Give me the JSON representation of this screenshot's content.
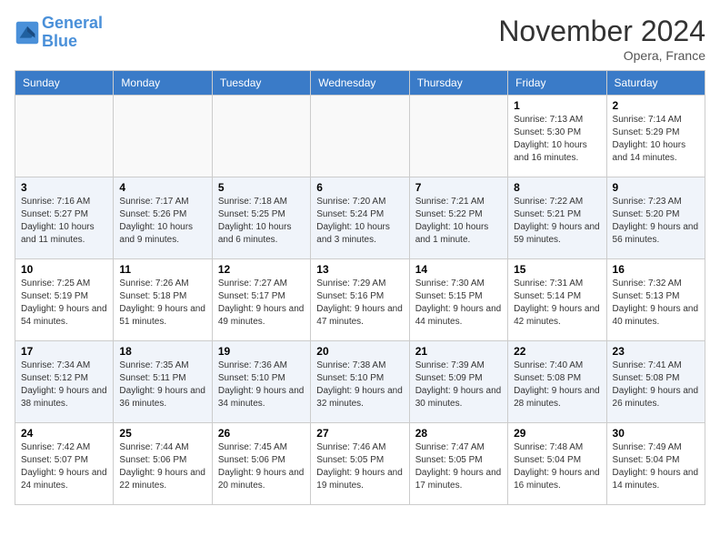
{
  "logo": {
    "text_general": "General",
    "text_blue": "Blue"
  },
  "title": "November 2024",
  "location": "Opera, France",
  "days_of_week": [
    "Sunday",
    "Monday",
    "Tuesday",
    "Wednesday",
    "Thursday",
    "Friday",
    "Saturday"
  ],
  "weeks": [
    [
      {
        "day": "",
        "sunrise": "",
        "sunset": "",
        "daylight": "",
        "empty": true
      },
      {
        "day": "",
        "sunrise": "",
        "sunset": "",
        "daylight": "",
        "empty": true
      },
      {
        "day": "",
        "sunrise": "",
        "sunset": "",
        "daylight": "",
        "empty": true
      },
      {
        "day": "",
        "sunrise": "",
        "sunset": "",
        "daylight": "",
        "empty": true
      },
      {
        "day": "",
        "sunrise": "",
        "sunset": "",
        "daylight": "",
        "empty": true
      },
      {
        "day": "1",
        "sunrise": "Sunrise: 7:13 AM",
        "sunset": "Sunset: 5:30 PM",
        "daylight": "Daylight: 10 hours and 16 minutes."
      },
      {
        "day": "2",
        "sunrise": "Sunrise: 7:14 AM",
        "sunset": "Sunset: 5:29 PM",
        "daylight": "Daylight: 10 hours and 14 minutes."
      }
    ],
    [
      {
        "day": "3",
        "sunrise": "Sunrise: 7:16 AM",
        "sunset": "Sunset: 5:27 PM",
        "daylight": "Daylight: 10 hours and 11 minutes."
      },
      {
        "day": "4",
        "sunrise": "Sunrise: 7:17 AM",
        "sunset": "Sunset: 5:26 PM",
        "daylight": "Daylight: 10 hours and 9 minutes."
      },
      {
        "day": "5",
        "sunrise": "Sunrise: 7:18 AM",
        "sunset": "Sunset: 5:25 PM",
        "daylight": "Daylight: 10 hours and 6 minutes."
      },
      {
        "day": "6",
        "sunrise": "Sunrise: 7:20 AM",
        "sunset": "Sunset: 5:24 PM",
        "daylight": "Daylight: 10 hours and 3 minutes."
      },
      {
        "day": "7",
        "sunrise": "Sunrise: 7:21 AM",
        "sunset": "Sunset: 5:22 PM",
        "daylight": "Daylight: 10 hours and 1 minute."
      },
      {
        "day": "8",
        "sunrise": "Sunrise: 7:22 AM",
        "sunset": "Sunset: 5:21 PM",
        "daylight": "Daylight: 9 hours and 59 minutes."
      },
      {
        "day": "9",
        "sunrise": "Sunrise: 7:23 AM",
        "sunset": "Sunset: 5:20 PM",
        "daylight": "Daylight: 9 hours and 56 minutes."
      }
    ],
    [
      {
        "day": "10",
        "sunrise": "Sunrise: 7:25 AM",
        "sunset": "Sunset: 5:19 PM",
        "daylight": "Daylight: 9 hours and 54 minutes."
      },
      {
        "day": "11",
        "sunrise": "Sunrise: 7:26 AM",
        "sunset": "Sunset: 5:18 PM",
        "daylight": "Daylight: 9 hours and 51 minutes."
      },
      {
        "day": "12",
        "sunrise": "Sunrise: 7:27 AM",
        "sunset": "Sunset: 5:17 PM",
        "daylight": "Daylight: 9 hours and 49 minutes."
      },
      {
        "day": "13",
        "sunrise": "Sunrise: 7:29 AM",
        "sunset": "Sunset: 5:16 PM",
        "daylight": "Daylight: 9 hours and 47 minutes."
      },
      {
        "day": "14",
        "sunrise": "Sunrise: 7:30 AM",
        "sunset": "Sunset: 5:15 PM",
        "daylight": "Daylight: 9 hours and 44 minutes."
      },
      {
        "day": "15",
        "sunrise": "Sunrise: 7:31 AM",
        "sunset": "Sunset: 5:14 PM",
        "daylight": "Daylight: 9 hours and 42 minutes."
      },
      {
        "day": "16",
        "sunrise": "Sunrise: 7:32 AM",
        "sunset": "Sunset: 5:13 PM",
        "daylight": "Daylight: 9 hours and 40 minutes."
      }
    ],
    [
      {
        "day": "17",
        "sunrise": "Sunrise: 7:34 AM",
        "sunset": "Sunset: 5:12 PM",
        "daylight": "Daylight: 9 hours and 38 minutes."
      },
      {
        "day": "18",
        "sunrise": "Sunrise: 7:35 AM",
        "sunset": "Sunset: 5:11 PM",
        "daylight": "Daylight: 9 hours and 36 minutes."
      },
      {
        "day": "19",
        "sunrise": "Sunrise: 7:36 AM",
        "sunset": "Sunset: 5:10 PM",
        "daylight": "Daylight: 9 hours and 34 minutes."
      },
      {
        "day": "20",
        "sunrise": "Sunrise: 7:38 AM",
        "sunset": "Sunset: 5:10 PM",
        "daylight": "Daylight: 9 hours and 32 minutes."
      },
      {
        "day": "21",
        "sunrise": "Sunrise: 7:39 AM",
        "sunset": "Sunset: 5:09 PM",
        "daylight": "Daylight: 9 hours and 30 minutes."
      },
      {
        "day": "22",
        "sunrise": "Sunrise: 7:40 AM",
        "sunset": "Sunset: 5:08 PM",
        "daylight": "Daylight: 9 hours and 28 minutes."
      },
      {
        "day": "23",
        "sunrise": "Sunrise: 7:41 AM",
        "sunset": "Sunset: 5:08 PM",
        "daylight": "Daylight: 9 hours and 26 minutes."
      }
    ],
    [
      {
        "day": "24",
        "sunrise": "Sunrise: 7:42 AM",
        "sunset": "Sunset: 5:07 PM",
        "daylight": "Daylight: 9 hours and 24 minutes."
      },
      {
        "day": "25",
        "sunrise": "Sunrise: 7:44 AM",
        "sunset": "Sunset: 5:06 PM",
        "daylight": "Daylight: 9 hours and 22 minutes."
      },
      {
        "day": "26",
        "sunrise": "Sunrise: 7:45 AM",
        "sunset": "Sunset: 5:06 PM",
        "daylight": "Daylight: 9 hours and 20 minutes."
      },
      {
        "day": "27",
        "sunrise": "Sunrise: 7:46 AM",
        "sunset": "Sunset: 5:05 PM",
        "daylight": "Daylight: 9 hours and 19 minutes."
      },
      {
        "day": "28",
        "sunrise": "Sunrise: 7:47 AM",
        "sunset": "Sunset: 5:05 PM",
        "daylight": "Daylight: 9 hours and 17 minutes."
      },
      {
        "day": "29",
        "sunrise": "Sunrise: 7:48 AM",
        "sunset": "Sunset: 5:04 PM",
        "daylight": "Daylight: 9 hours and 16 minutes."
      },
      {
        "day": "30",
        "sunrise": "Sunrise: 7:49 AM",
        "sunset": "Sunset: 5:04 PM",
        "daylight": "Daylight: 9 hours and 14 minutes."
      }
    ]
  ]
}
